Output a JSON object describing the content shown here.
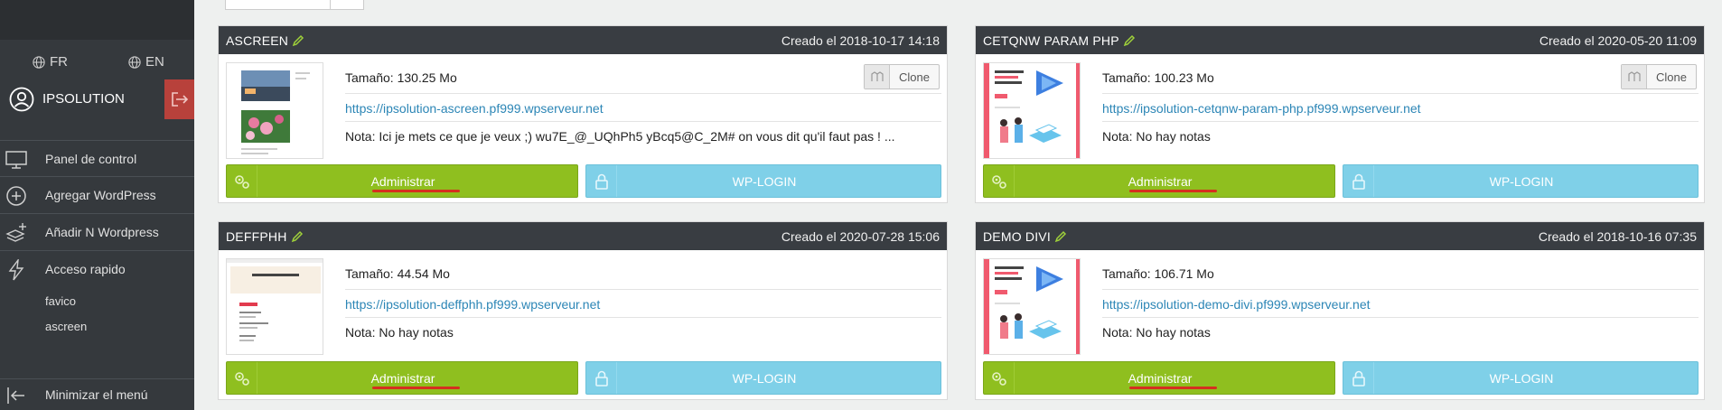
{
  "sidebar": {
    "languages": [
      "FR",
      "EN"
    ],
    "user": "IPSOLUTION",
    "nav": [
      {
        "label": "Panel de control",
        "icon": "monitor-icon"
      },
      {
        "label": "Agregar WordPress",
        "icon": "plus-circle-icon"
      },
      {
        "label": "Añadir N Wordpress",
        "icon": "layers-plus-icon"
      },
      {
        "label": "Acceso rapido",
        "icon": "lightning-icon"
      }
    ],
    "quick_links": [
      "favico",
      "ascreen"
    ],
    "minimize_label": "Minimizar el menú"
  },
  "cards": [
    {
      "title": "ASCREEN",
      "date": "Creado el 2018-10-17 14:18",
      "size": "Tamaño: 130.25 Mo",
      "url": "https://ipsolution-ascreen.pf999.wpserveur.net",
      "note": "Nota: Ici je mets ce que je veux ;) wu7E_@_UQhPh5 yBcq5@C_2M# on vous dit qu'il faut pas ! ...",
      "clone_label": "Clone",
      "admin_label": "Administrar",
      "wp_label": "WP-LOGIN"
    },
    {
      "title": "CETQNW PARAM PHP",
      "date": "Creado el 2020-05-20 11:09",
      "size": "Tamaño: 100.23 Mo",
      "url": "https://ipsolution-cetqnw-param-php.pf999.wpserveur.net",
      "note": "Nota: No hay notas",
      "clone_label": "Clone",
      "admin_label": "Administrar",
      "wp_label": "WP-LOGIN"
    },
    {
      "title": "DEFFPHH",
      "date": "Creado el 2020-07-28 15:06",
      "size": "Tamaño: 44.54 Mo",
      "url": "https://ipsolution-deffphh.pf999.wpserveur.net",
      "note": "Nota: No hay notas",
      "admin_label": "Administrar",
      "wp_label": "WP-LOGIN"
    },
    {
      "title": "DEMO DIVI",
      "date": "Creado el 2018-10-16 07:35",
      "size": "Tamaño: 106.71 Mo",
      "url": "https://ipsolution-demo-divi.pf999.wpserveur.net",
      "note": "Nota: No hay notas",
      "admin_label": "Administrar",
      "wp_label": "WP-LOGIN"
    }
  ],
  "colors": {
    "sidebar_bg": "#35393d",
    "card_header": "#393d42",
    "admin_green": "#8fbf1f",
    "wp_blue": "#7fd0e8",
    "logout_red": "#b8413b",
    "link": "#2c86b6",
    "annotation_red": "#d5301f"
  }
}
